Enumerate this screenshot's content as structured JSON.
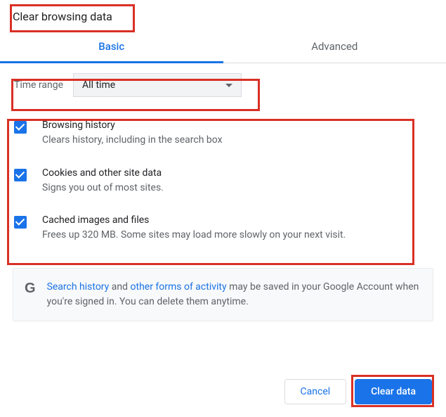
{
  "title": "Clear browsing data",
  "tabs": {
    "basic": "Basic",
    "advanced": "Advanced"
  },
  "timeRange": {
    "label": "Time range",
    "value": "All time"
  },
  "options": [
    {
      "title": "Browsing history",
      "desc": "Clears history, including in the search box"
    },
    {
      "title": "Cookies and other site data",
      "desc": "Signs you out of most sites."
    },
    {
      "title": "Cached images and files",
      "desc": "Frees up 320 MB. Some sites may load more slowly on your next visit."
    }
  ],
  "info": {
    "link1": "Search history",
    "mid1": " and ",
    "link2": "other forms of activity",
    "tail": " may be saved in your Google Account when you're signed in. You can delete them anytime."
  },
  "buttons": {
    "cancel": "Cancel",
    "clear": "Clear data"
  }
}
